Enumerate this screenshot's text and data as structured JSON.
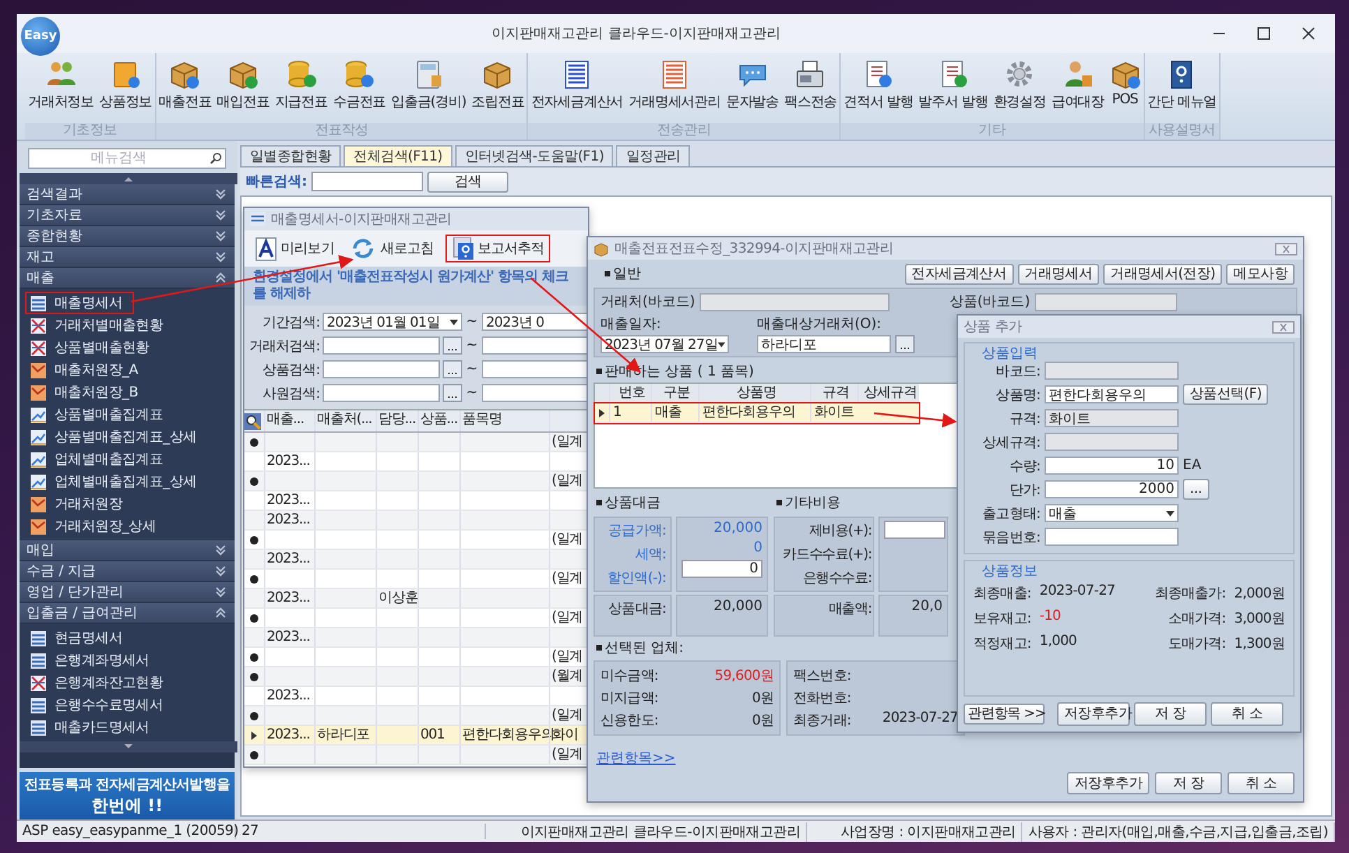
{
  "app": {
    "logo": "Easy",
    "title": "이지판매재고관리 클라우드-이지판매재고관리"
  },
  "ribbon": [
    {
      "label": "기초정보",
      "buttons": [
        {
          "label": "거래처정보",
          "kind": "people"
        },
        {
          "label": "상품정보",
          "kind": "folder"
        }
      ]
    },
    {
      "label": "전표작성",
      "buttons": [
        {
          "label": "매출전표",
          "kind": "box-up"
        },
        {
          "label": "매입전표",
          "kind": "box-down"
        },
        {
          "label": "지급전표",
          "kind": "coins-minus"
        },
        {
          "label": "수금전표",
          "kind": "coins-plus"
        },
        {
          "label": "입출금(경비)",
          "kind": "calculator"
        },
        {
          "label": "조립전표",
          "kind": "boxes"
        }
      ]
    },
    {
      "label": "전송관리",
      "buttons": [
        {
          "label": "전자세금계산서",
          "kind": "invoice"
        },
        {
          "label": "거래명세서관리",
          "kind": "statement"
        },
        {
          "label": "문자발송",
          "kind": "message"
        },
        {
          "label": "팩스전송",
          "kind": "fax"
        }
      ]
    },
    {
      "label": "기타",
      "buttons": [
        {
          "label": "견적서 발행",
          "kind": "quote"
        },
        {
          "label": "발주서 발행",
          "kind": "order"
        },
        {
          "label": "환경설정",
          "kind": "gear"
        },
        {
          "label": "급여대장",
          "kind": "person"
        },
        {
          "label": "POS",
          "kind": "pos"
        }
      ]
    },
    {
      "label": "사용설명서",
      "buttons": [
        {
          "label": "간단 메뉴얼",
          "kind": "manual"
        }
      ]
    }
  ],
  "sidebar": {
    "search_placeholder": "메뉴검색",
    "sections": [
      {
        "label": "검색결과",
        "expanded": false
      },
      {
        "label": "기초자료",
        "expanded": false
      },
      {
        "label": "종합현황",
        "expanded": false
      },
      {
        "label": "재고",
        "expanded": false
      },
      {
        "label": "매출",
        "expanded": true,
        "items": [
          {
            "label": "매출명세서",
            "kind": "list",
            "highlighted": true
          },
          {
            "label": "거래처별매출현황",
            "kind": "cross",
            "highlighted": false
          },
          {
            "label": "상품별매출현황",
            "kind": "cross",
            "highlighted": false
          },
          {
            "label": "매출처원장_A",
            "kind": "ledger",
            "highlighted": false
          },
          {
            "label": "매출처원장_B",
            "kind": "ledger",
            "highlighted": false
          },
          {
            "label": "상품별매출집계표",
            "kind": "trend",
            "highlighted": false
          },
          {
            "label": "상품별매출집계표_상세",
            "kind": "trend",
            "highlighted": false
          },
          {
            "label": "업체별매출집계표",
            "kind": "trend",
            "highlighted": false
          },
          {
            "label": "업체별매출집계표_상세",
            "kind": "trend",
            "highlighted": false
          },
          {
            "label": "거래처원장",
            "kind": "ledger",
            "highlighted": false
          },
          {
            "label": "거래처원장_상세",
            "kind": "ledger",
            "highlighted": false
          }
        ]
      },
      {
        "label": "매입",
        "expanded": false
      },
      {
        "label": "수금 / 지급",
        "expanded": false
      },
      {
        "label": "영업 / 단가관리",
        "expanded": false
      },
      {
        "label": "입출금 / 급여관리",
        "expanded": true,
        "items": [
          {
            "label": "현금명세서",
            "kind": "list",
            "highlighted": false
          },
          {
            "label": "은행계좌명세서",
            "kind": "list",
            "highlighted": false
          },
          {
            "label": "은행계좌잔고현황",
            "kind": "cross",
            "highlighted": false
          },
          {
            "label": "은행수수료명세서",
            "kind": "list",
            "highlighted": false
          },
          {
            "label": "매출카드명세서",
            "kind": "list",
            "highlighted": false
          }
        ]
      }
    ],
    "banner": [
      "전표등록과 전자세금계산서발행을",
      "한번에 !!"
    ]
  },
  "tabs": [
    {
      "label": "일별종합현황",
      "selected": false
    },
    {
      "label": "전체검색(F11)",
      "selected": true
    },
    {
      "label": "인터넷검색-도움말(F1)",
      "selected": false
    },
    {
      "label": "일정관리",
      "selected": false
    }
  ],
  "quick_search": {
    "label": "빠른검색:",
    "button": "검색"
  },
  "sales_window": {
    "title": "매출명세서-이지판매재고관리",
    "tools": [
      {
        "label": "미리보기",
        "kind": "preview",
        "highlighted": false
      },
      {
        "label": "새로고침",
        "kind": "refresh",
        "highlighted": false
      },
      {
        "label": "보고서추적",
        "kind": "help",
        "highlighted": true
      }
    ],
    "notice": "환경설정에서 '매출전표작성시 원가계산' 항목의 체크를 해제하",
    "filters": [
      {
        "label": "기간검색:",
        "kind": "date",
        "value": "2023년 01월 01일",
        "range_mark": "~",
        "to_value": "2023년 0"
      },
      {
        "label": "거래처검색:",
        "kind": "lookup",
        "button": "...",
        "range_mark": "~"
      },
      {
        "label": "상품검색:",
        "kind": "lookup",
        "button": "...",
        "range_mark": "~"
      },
      {
        "label": "사원검색:",
        "kind": "lookup",
        "button": "...",
        "range_mark": "~"
      }
    ],
    "table": {
      "columns": [
        "매출...",
        "매출처(...",
        "담당...",
        "상품...",
        "품목명"
      ],
      "rows": [
        {
          "expandable": true,
          "selected": false,
          "cells": [
            "",
            "",
            "",
            "",
            "",
            "(일계"
          ]
        },
        {
          "expandable": false,
          "selected": false,
          "cells": [
            "2023...",
            "",
            "",
            "",
            "",
            ""
          ]
        },
        {
          "expandable": true,
          "selected": false,
          "cells": [
            "",
            "",
            "",
            "",
            "",
            "(일계"
          ]
        },
        {
          "expandable": false,
          "selected": false,
          "cells": [
            "2023...",
            "",
            "",
            "",
            "",
            ""
          ]
        },
        {
          "expandable": false,
          "selected": false,
          "cells": [
            "2023...",
            "",
            "",
            "",
            "",
            ""
          ]
        },
        {
          "expandable": true,
          "selected": false,
          "cells": [
            "",
            "",
            "",
            "",
            "",
            "(일계"
          ]
        },
        {
          "expandable": false,
          "selected": false,
          "cells": [
            "2023...",
            "",
            "",
            "",
            "",
            ""
          ]
        },
        {
          "expandable": true,
          "selected": false,
          "cells": [
            "",
            "",
            "",
            "",
            "",
            "(일계"
          ]
        },
        {
          "expandable": false,
          "selected": false,
          "cells": [
            "2023...",
            "",
            "이상훈",
            "",
            "",
            ""
          ]
        },
        {
          "expandable": true,
          "selected": false,
          "cells": [
            "",
            "",
            "",
            "",
            "",
            "(일계"
          ]
        },
        {
          "expandable": false,
          "selected": false,
          "cells": [
            "2023...",
            "",
            "",
            "",
            "",
            ""
          ]
        },
        {
          "expandable": true,
          "selected": false,
          "cells": [
            "",
            "",
            "",
            "",
            "",
            "(일계"
          ]
        },
        {
          "expandable": true,
          "selected": false,
          "cells": [
            "",
            "",
            "",
            "",
            "",
            "(월계"
          ]
        },
        {
          "expandable": false,
          "selected": false,
          "cells": [
            "2023...",
            "",
            "",
            "",
            "",
            ""
          ]
        },
        {
          "expandable": true,
          "selected": false,
          "cells": [
            "",
            "",
            "",
            "",
            "",
            "(일계"
          ]
        },
        {
          "expandable": false,
          "selected": true,
          "cells": [
            "2023...",
            "하라디포",
            "",
            "001",
            "편한다회용우의",
            "화이"
          ]
        },
        {
          "expandable": true,
          "selected": false,
          "cells": [
            "",
            "",
            "",
            "",
            "",
            "(일계"
          ]
        }
      ]
    }
  },
  "edit_window": {
    "title": "매출전표전표수정_332994-이지판매재고관리",
    "buttons": [
      "전자세금계산서",
      "거래명세서",
      "거래명세서(전장)",
      "메모사항"
    ],
    "general": {
      "heading": "일반",
      "barcode_label": "거래처(바코드)",
      "product_barcode_label": "상품(바코드)",
      "date_label": "매출일자:",
      "date": "2023년 07월 27일",
      "client_label": "매출대상거래처(O):",
      "client": "하라디포",
      "lookup_button": "..."
    },
    "products": {
      "heading": "판매하는 상품 ( 1 품목)",
      "columns": [
        "번호",
        "구분",
        "상품명",
        "규격",
        "상세규격"
      ],
      "rows": [
        {
          "selected": true,
          "highlighted": true,
          "cells": [
            "1",
            "매출",
            "편한다회용우의",
            "화이트",
            ""
          ]
        }
      ]
    },
    "amounts": {
      "heading": "상품대금",
      "lines": [
        {
          "label": "공급가액:",
          "value": "20,000",
          "kind": "text"
        },
        {
          "label": "세액:",
          "value": "0",
          "kind": "text"
        },
        {
          "label": "할인액(-):",
          "value": "0",
          "kind": "input"
        }
      ],
      "total_label": "상품대금:",
      "total": "20,000"
    },
    "costs": {
      "heading": "기타비용",
      "lines": [
        {
          "label": "제비용(+):",
          "kind": "input"
        },
        {
          "label": "카드수수료(+):",
          "kind": "text"
        },
        {
          "label": "은행수수료:",
          "kind": "text"
        }
      ],
      "total_label": "매출액:",
      "total": "20,0"
    },
    "company": {
      "heading": "선택된 업체:",
      "left": [
        {
          "label": "미수금액:",
          "value": "59,600원",
          "alert": true
        },
        {
          "label": "미지급액:",
          "value": "0원",
          "alert": false
        },
        {
          "label": "신용한도:",
          "value": "0원",
          "alert": false
        }
      ],
      "right": [
        {
          "label": "팩스번호:"
        },
        {
          "label": "전화번호:"
        },
        {
          "label": "최종거래:",
          "value": "2023-07-27"
        }
      ]
    },
    "link": "관련항목>>",
    "footer_buttons": [
      "저장후추가",
      "저 장",
      "취 소"
    ]
  },
  "add_window": {
    "title": "상품 추가",
    "input_group": {
      "heading": "상품입력",
      "fields": [
        {
          "label": "바코드:",
          "kind": "disabled"
        },
        {
          "label": "상품명:",
          "kind": "input",
          "value": "편한다회용우의",
          "button": "상품선택(F)"
        },
        {
          "label": "규격:",
          "kind": "disabled",
          "value": "화이트"
        },
        {
          "label": "상세규격:",
          "kind": "disabled"
        },
        {
          "label": "수량:",
          "kind": "number",
          "value": "10",
          "unit": "EA"
        },
        {
          "label": "단가:",
          "kind": "number",
          "value": "2000",
          "button": "..."
        },
        {
          "label": "출고형태:",
          "kind": "select",
          "value": "매출"
        },
        {
          "label": "묶음번호:",
          "kind": "input"
        }
      ]
    },
    "info_group": {
      "heading": "상품정보",
      "items": [
        {
          "label": "최종매출:",
          "value": "2023-07-27",
          "alert": false
        },
        {
          "label": "최종매출가:",
          "value": "2,000원",
          "alert": false
        },
        {
          "label": "보유재고:",
          "value": "-10",
          "alert": true
        },
        {
          "label": "소매가격:",
          "value": "3,000원",
          "alert": false
        },
        {
          "label": "적정재고:",
          "value": "1,000",
          "alert": false
        },
        {
          "label": "도매가격:",
          "value": "1,300원",
          "alert": false
        }
      ]
    },
    "link_button": "관련항목 >>",
    "buttons": [
      "저장후추가",
      "저 장",
      "취 소"
    ]
  },
  "status_bar": [
    "ASP easy_easypanme_1 (20059)",
    "27",
    "이지판매재고관리 클라우드-이지판매재고관리",
    "사업장명 : 이지판매재고관리",
    "사용자 : 관리자(매입,매출,수금,지급,입출금,조립)"
  ]
}
